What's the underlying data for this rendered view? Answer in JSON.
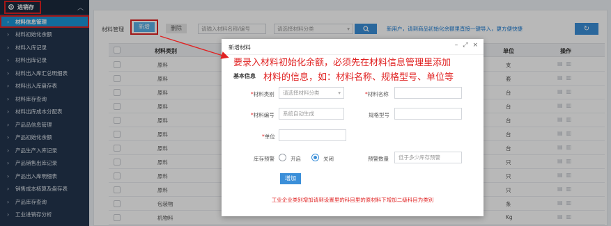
{
  "sidebar": {
    "header": {
      "icon": "gear-icon",
      "label": "进销存",
      "chevron": "chevron-up-icon"
    },
    "items": [
      {
        "label": "材料信息管理",
        "active": true
      },
      {
        "label": "材料初始化余额"
      },
      {
        "label": "材料入库记录"
      },
      {
        "label": "材料出库记录"
      },
      {
        "label": "材料出入库汇总明细表"
      },
      {
        "label": "材料出入库盘存表"
      },
      {
        "label": "材料库存查询"
      },
      {
        "label": "材料出库成本分配表"
      },
      {
        "label": "产品品信息管理"
      },
      {
        "label": "产品初始化余额"
      },
      {
        "label": "产品生产入库记录"
      },
      {
        "label": "产品销售出库记录"
      },
      {
        "label": "产品出入库明细表"
      },
      {
        "label": "销售成本核算及盘存表"
      },
      {
        "label": "产品库存查询"
      },
      {
        "label": "工业进销存分析"
      }
    ]
  },
  "toolbar": {
    "section_label": "材料管理",
    "new_label": "新增",
    "delete_label": "删除",
    "search_placeholder": "请输入材料名称/编号",
    "category_placeholder": "请选择材料分类",
    "search_icon": "search-icon",
    "hint": "新用户，请到商品初始化余额里直接一键导入，更方便快捷",
    "refresh_icon": "refresh-icon"
  },
  "table": {
    "headers": {
      "category": "材料类别",
      "unit": "单位",
      "actions": "操作"
    },
    "rows": [
      {
        "category": "原料",
        "unit": "支"
      },
      {
        "category": "原料",
        "unit": "套"
      },
      {
        "category": "原料",
        "unit": "台"
      },
      {
        "category": "原料",
        "unit": "台"
      },
      {
        "category": "原料",
        "unit": "台"
      },
      {
        "category": "原料",
        "unit": "台"
      },
      {
        "category": "原料",
        "unit": "台"
      },
      {
        "category": "原料",
        "unit": "只"
      },
      {
        "category": "原料",
        "unit": "只"
      },
      {
        "category": "原料",
        "unit": "只"
      },
      {
        "category": "包装物",
        "unit": "条"
      },
      {
        "category": "机物料",
        "unit": "Kg"
      }
    ]
  },
  "modal": {
    "title": "新增材料",
    "controls": {
      "minimize": "–",
      "maximize": "⤢",
      "close": "×"
    },
    "note_line1": "要录入材料初始化余额，必须先在材料信息管理里添加",
    "note_line2": "材料的信息，如：材料名称、规格型号、单位等",
    "section": "基本信息",
    "fields": {
      "category_label": "材料类别",
      "category_placeholder": "请选择材料分类",
      "name_label": "材料名称",
      "code_label": "材料编号",
      "code_placeholder": "系统自动生成",
      "spec_label": "规格型号",
      "unit_label": "单位",
      "stock_warn_label": "库存预警",
      "radio_on": "开启",
      "radio_off": "关闭",
      "warn_qty_label": "预警数量",
      "warn_qty_placeholder": "低于多少库存预警"
    },
    "add_label": "增加",
    "footer_note": "工业企业类别增加请到设置里的科目里的原材料下增加二级科目为类别"
  },
  "colors": {
    "accent": "#3b8fd9",
    "annotation": "#e02222",
    "sidebar_bg": "#23354e",
    "active": "#1996d8"
  }
}
